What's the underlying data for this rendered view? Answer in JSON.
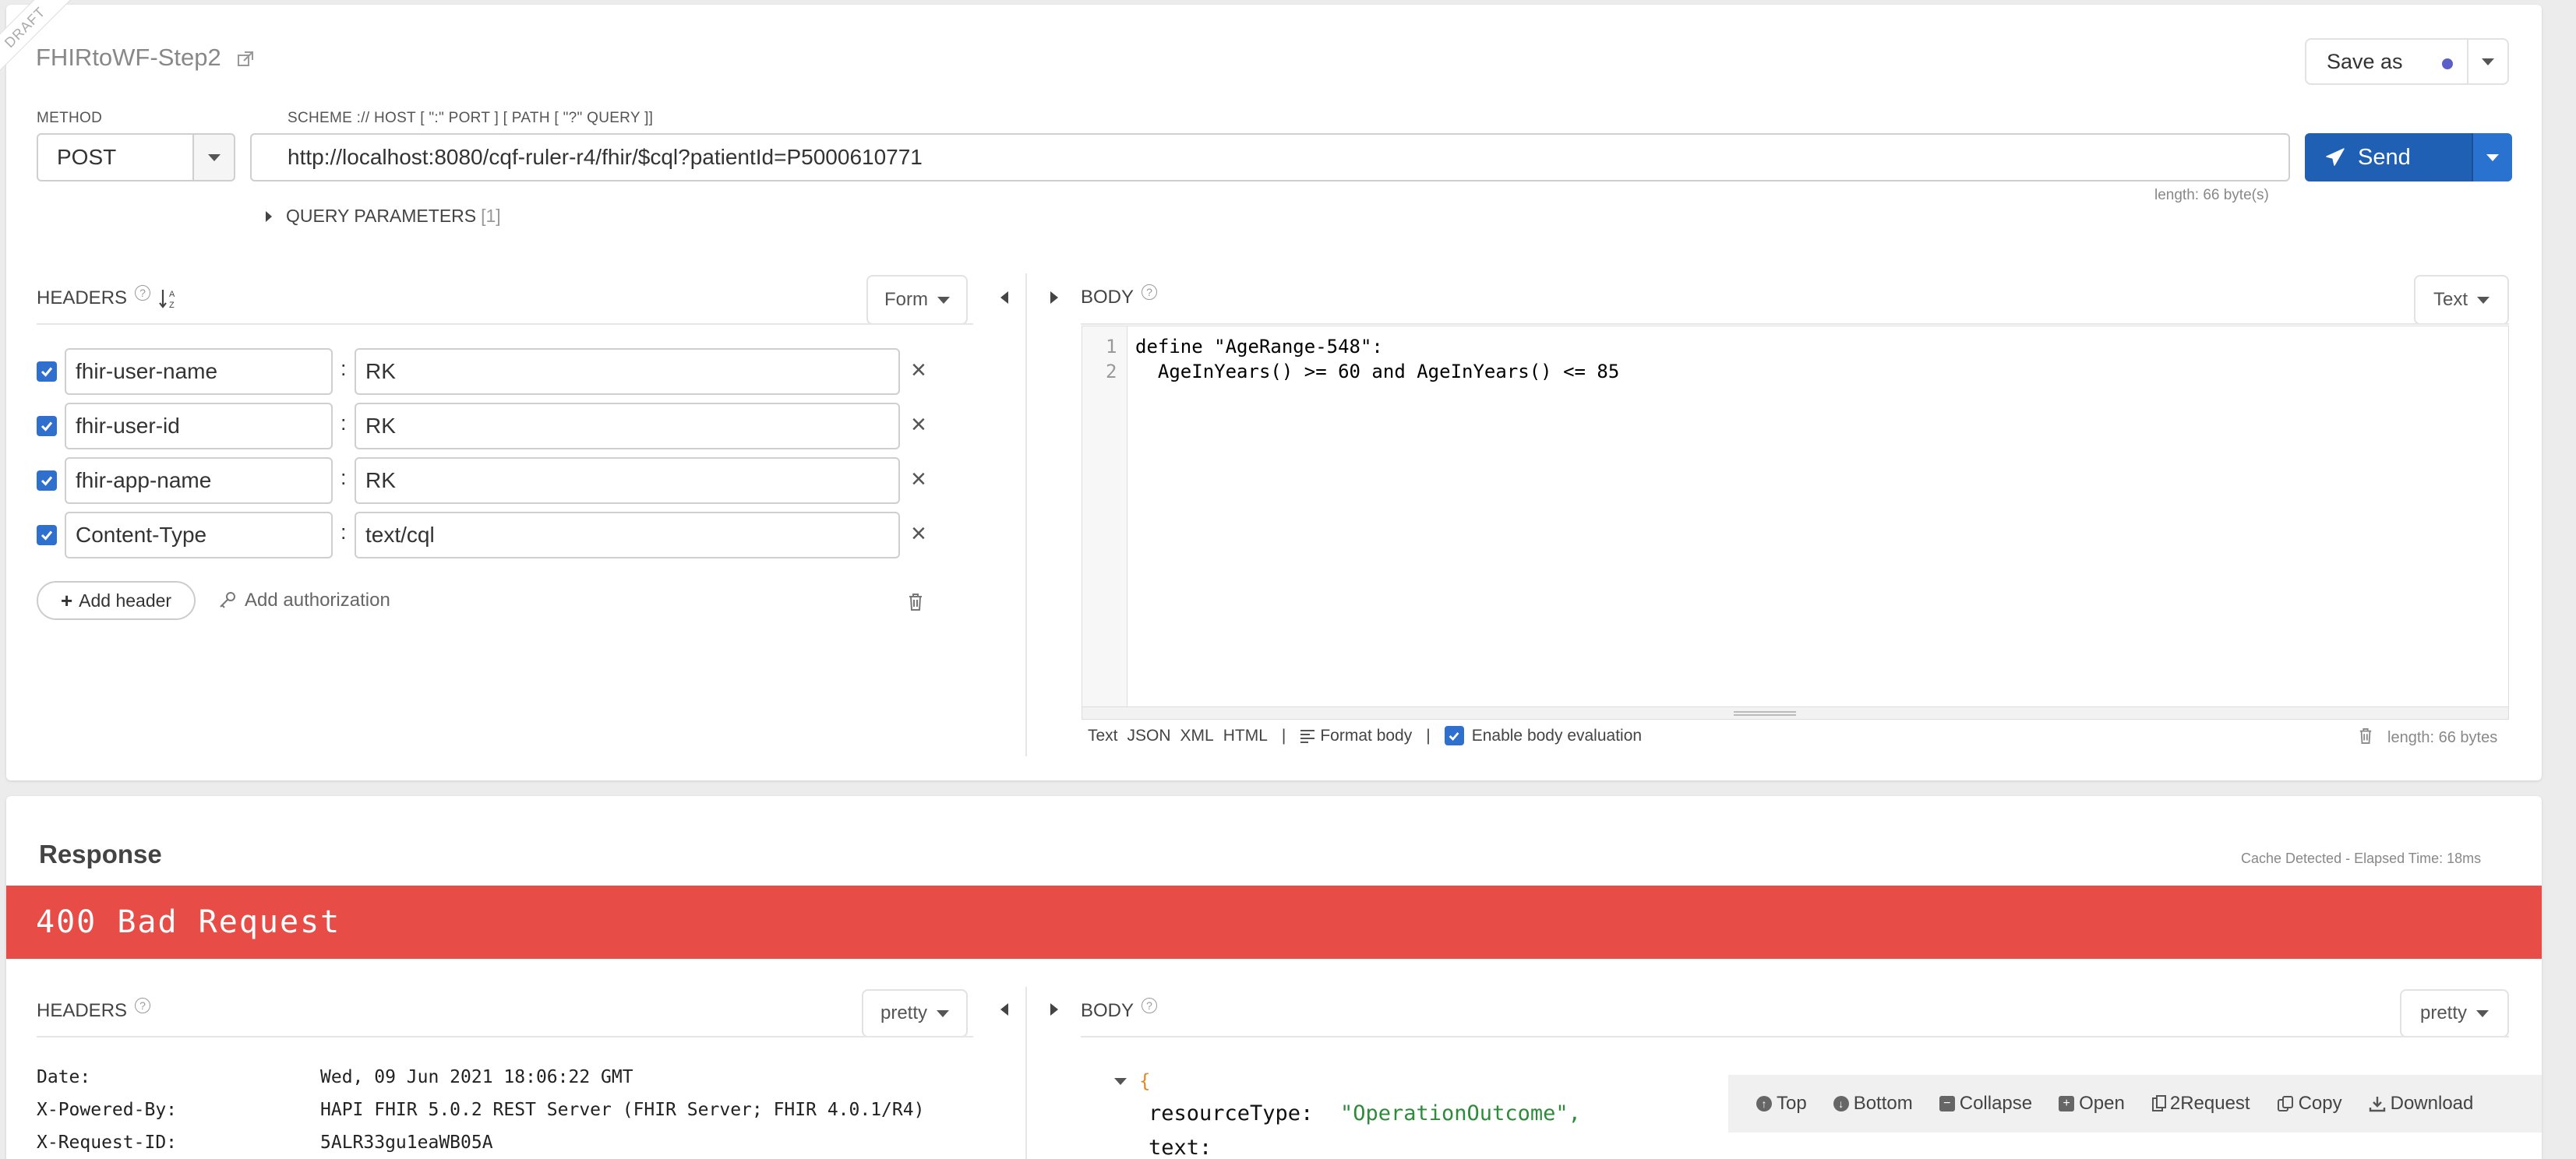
{
  "request": {
    "draft_badge": "DRAFT",
    "title": "FHIRtoWF-Step2",
    "save_as_label": "Save as",
    "method_label": "METHOD",
    "method_value": "POST",
    "url_label": "SCHEME :// HOST [ \":\" PORT ] [ PATH [ \"?\" QUERY ]]",
    "url_value": "http://localhost:8080/cqf-ruler-r4/fhir/$cql?patientId=P5000610771",
    "send_label": "Send",
    "url_length": "length: 66 byte(s)",
    "query_params_label": "QUERY PARAMETERS",
    "query_params_count": "[1]",
    "headers_label": "HEADERS",
    "headers_mode": "Form",
    "headers": [
      {
        "name": "fhir-user-name",
        "value": "RK"
      },
      {
        "name": "fhir-user-id",
        "value": "RK"
      },
      {
        "name": "fhir-app-name",
        "value": "RK"
      },
      {
        "name": "Content-Type",
        "value": "text/cql"
      }
    ],
    "add_header_label": "Add header",
    "add_auth_label": "Add authorization",
    "body_label": "BODY",
    "body_mode": "Text",
    "body_lines": [
      {
        "num": "1",
        "text": "define \"AgeRange-548\":"
      },
      {
        "num": "2",
        "text": "  AgeInYears() >= 60 and AgeInYears() <= 85"
      }
    ],
    "body_formats": [
      "Text",
      "JSON",
      "XML",
      "HTML"
    ],
    "format_body_label": "Format body",
    "enable_eval_label": "Enable body evaluation",
    "body_length": "length: 66 bytes"
  },
  "response": {
    "title": "Response",
    "cache_info": "Cache Detected - Elapsed Time: 18ms",
    "status": "400 Bad Request",
    "status_color": "#e84c47",
    "headers_label": "HEADERS",
    "headers_mode": "pretty",
    "headers": [
      {
        "name": "Date:",
        "value": "Wed, 09 Jun 2021 18:06:22 GMT"
      },
      {
        "name": "X-Powered-By:",
        "value": "HAPI FHIR 5.0.2 REST Server (FHIR Server; FHIR 4.0.1/R4)"
      },
      {
        "name": "X-Request-ID:",
        "value": "5ALR33gu1eaWB05A"
      }
    ],
    "body_label": "BODY",
    "body_mode": "pretty",
    "body_key1": "resourceType:",
    "body_val1": "\"OperationOutcome\",",
    "body_key2": "text:",
    "toolbar": [
      "Top",
      "Bottom",
      "Collapse",
      "Open",
      "2Request",
      "Copy",
      "Download"
    ]
  },
  "colors": {
    "accent": "#2f6fce",
    "send_bg": "#1f5fb4",
    "error": "#e84c47"
  }
}
